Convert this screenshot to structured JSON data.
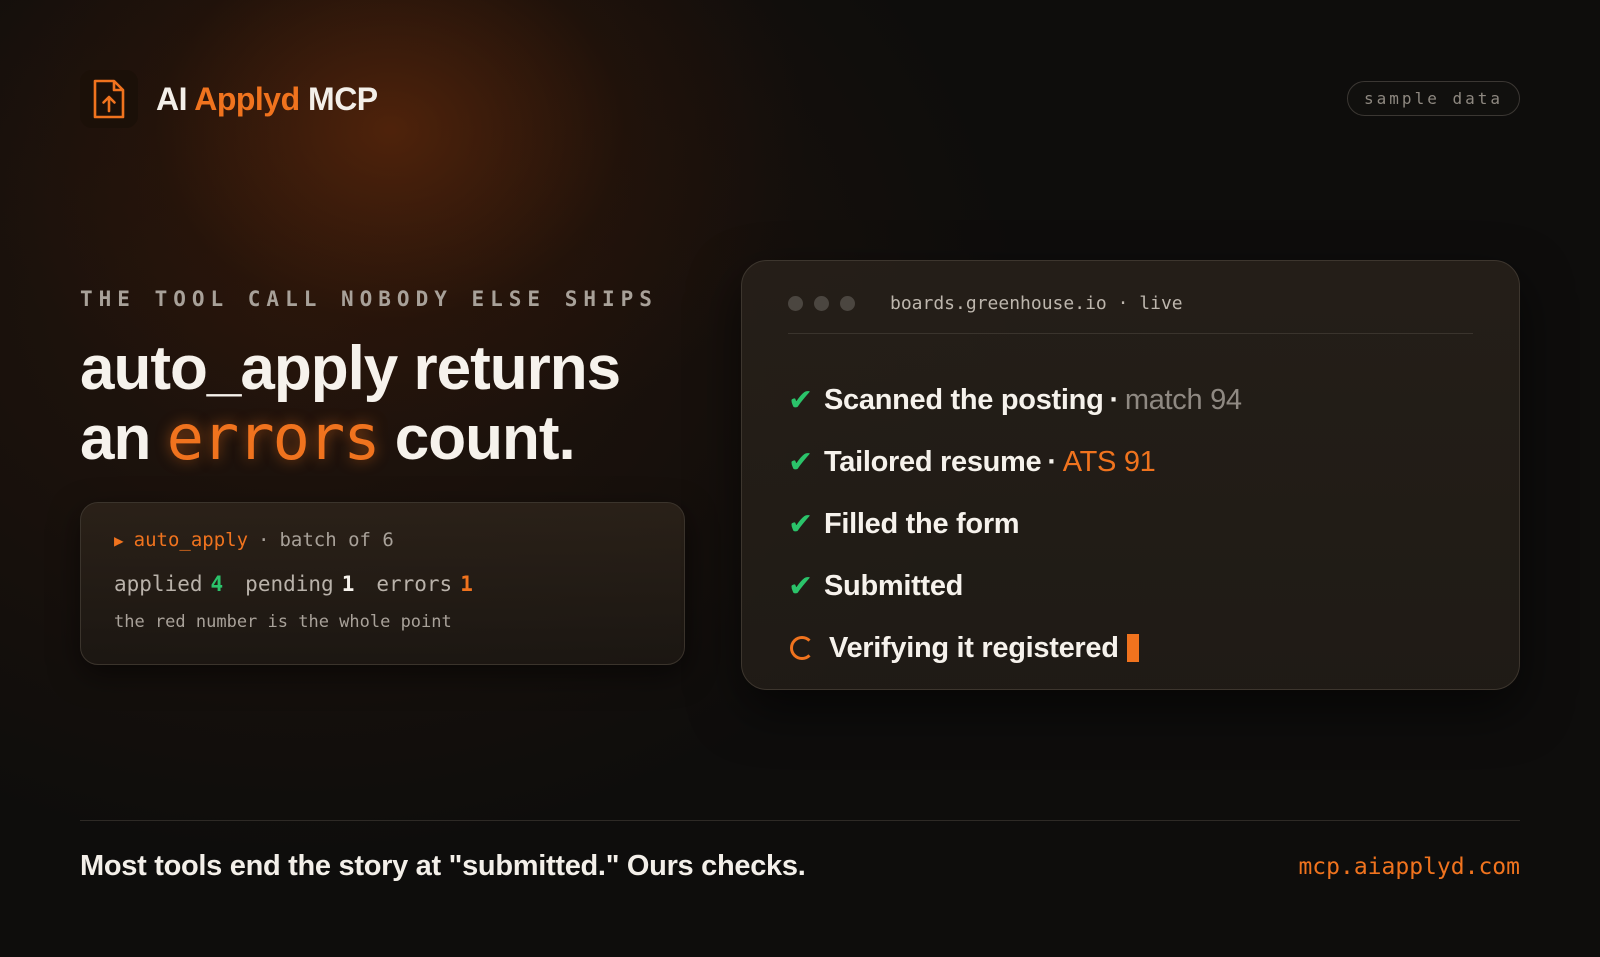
{
  "brand": {
    "name_prefix": "AI",
    "name_accent": "Applyd",
    "name_suffix": "MCP",
    "logo_icon": "upload-file-icon"
  },
  "badge": "sample data",
  "eyebrow": "THE TOOL CALL NOBODY ELSE SHIPS",
  "headline": {
    "line1": "auto_apply returns",
    "line2_before": "an",
    "line2_highlight": "errors",
    "line2_after": "count."
  },
  "batch": {
    "function": "auto_apply",
    "separator": "·",
    "label": "batch of 6",
    "stats": [
      {
        "label": "applied",
        "value": "4",
        "color": "#2bc36a"
      },
      {
        "label": "pending",
        "value": "1",
        "color": "#f6f2ec"
      },
      {
        "label": "errors",
        "value": "1",
        "color": "#f0731e"
      }
    ],
    "note": "the red number is the whole point"
  },
  "browser": {
    "url": "boards.greenhouse.io",
    "separator": "·",
    "status": "live",
    "steps": [
      {
        "text": "Scanned the posting",
        "detail": "match 94",
        "state": "done"
      },
      {
        "text": "Tailored resume",
        "detail": "ATS 91",
        "state": "done"
      },
      {
        "text": "Filled the form",
        "detail": "",
        "state": "done"
      },
      {
        "text": "Submitted",
        "detail": "",
        "state": "done"
      },
      {
        "text": "Verifying it registered",
        "detail": "",
        "state": "in-progress"
      }
    ]
  },
  "footer": {
    "tagline": "Most tools end the story at \"submitted.\" Ours checks.",
    "site": "mcp.aiapplyd.com"
  },
  "colors": {
    "accent": "#f0731e",
    "success": "#2bc36a",
    "background": "#0e0d0c"
  }
}
